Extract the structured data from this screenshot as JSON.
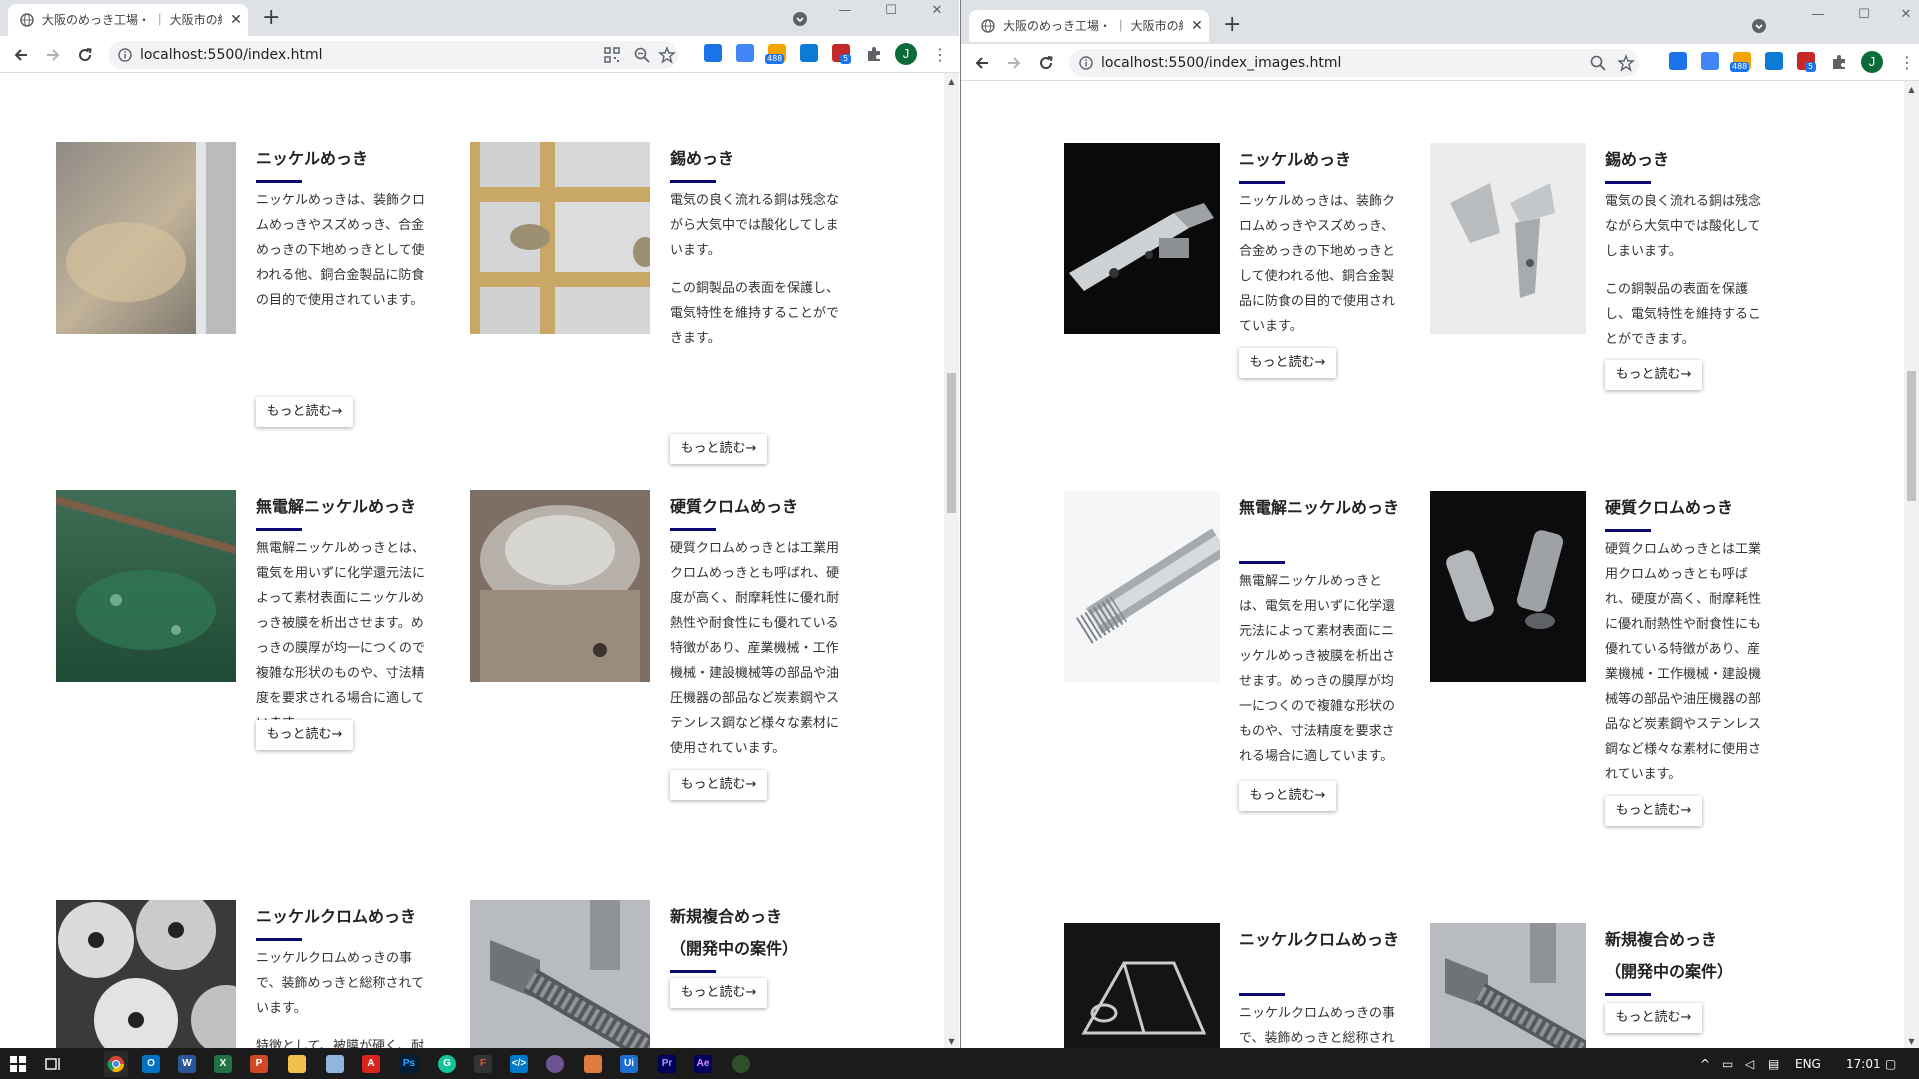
{
  "left_window": {
    "tab_title": "大阪のめっき工場・ ｜ 大阪市の紗",
    "url": "localhost:5500/index.html",
    "badge_count": "488",
    "ext_badge": "5",
    "profile_initial": "J",
    "cards": [
      {
        "title": "ニッケルめっき",
        "paragraphs": [
          "ニッケルめっきは、装飾クロムめっきやスズめっき、合金めっきの下地めっきとして使われる他、銅合金製品に防食の目的で使用されています。"
        ],
        "button": "もっと読む→"
      },
      {
        "title": "錫めっき",
        "paragraphs": [
          "電気の良く流れる銅は残念ながら大気中では酸化してしまいます。",
          "この銅製品の表面を保護し、電気特性を維持することができます。"
        ],
        "button": "もっと読む→"
      },
      {
        "title": "無電解ニッケルめっき",
        "paragraphs": [
          "無電解ニッケルめっきとは、電気を用いずに化学還元法によって素材表面にニッケルめっき被膜を析出させます。めっきの膜厚が均一につくので複雑な形状のものや、寸法精度を要求される場合に適しています。"
        ],
        "button": "もっと読む→"
      },
      {
        "title": "硬質クロムめっき",
        "paragraphs": [
          "硬質クロムめっきとは工業用クロムめっきとも呼ばれ、硬度が高く、耐摩耗性に優れ耐熱性や耐食性にも優れている特徴があり、産業機械・工作機械・建設機械等の部品や油圧機器の部品など炭素鋼やステンレス鋼など様々な素材に使用されています。"
        ],
        "button": "もっと読む→"
      },
      {
        "title": "ニッケルクロムめっき",
        "paragraphs": [
          "ニッケルクロムめっきの事で、装飾めっきと総称されています。",
          "特徴として、被膜が硬く、耐摩"
        ],
        "button": ""
      },
      {
        "title": "新規複合めっき（開発中の案件）",
        "paragraphs": [],
        "button": "もっと読む→"
      }
    ]
  },
  "right_window": {
    "tab_title": "大阪のめっき工場・ ｜ 大阪市の紗",
    "url": "localhost:5500/index_images.html",
    "badge_count": "488",
    "ext_badge": "5",
    "profile_initial": "J",
    "cards": [
      {
        "title": "ニッケルめっき",
        "paragraphs": [
          "ニッケルめっきは、装飾クロムめっきやスズめっき、合金めっきの下地めっきとして使われる他、銅合金製品に防食の目的で使用されています。"
        ],
        "button": "もっと読む→"
      },
      {
        "title": "錫めっき",
        "paragraphs": [
          "電気の良く流れる銅は残念ながら大気中では酸化してしまいます。",
          "この銅製品の表面を保護し、電気特性を維持することができます。"
        ],
        "button": "もっと読む→"
      },
      {
        "title": "無電解ニッケルめっき",
        "paragraphs": [
          "無電解ニッケルめっきとは、電気を用いずに化学還元法によって素材表面にニッケルめっき被膜を析出させます。めっきの膜厚が均一につくので複雑な形状のものや、寸法精度を要求される場合に適しています。"
        ],
        "button": "もっと読む→"
      },
      {
        "title": "硬質クロムめっき",
        "paragraphs": [
          "硬質クロムめっきとは工業用クロムめっきとも呼ばれ、硬度が高く、耐摩耗性に優れ耐熱性や耐食性にも優れている特徴があり、産業機械・工作機械・建設機械等の部品や油圧機器の部品など炭素鋼やステンレス鋼など様々な素材に使用されています。"
        ],
        "button": "もっと読む→"
      },
      {
        "title": "ニッケルクロムめっき",
        "paragraphs": [
          "ニッケルクロムめっきの事で、装飾めっきと総称され"
        ],
        "button": ""
      },
      {
        "title": "新規複合めっき（開発中の案件）",
        "paragraphs": [],
        "button": "もっと読む→"
      }
    ]
  },
  "taskbar": {
    "apps": [
      "chrome-icon",
      "outlook-icon",
      "word-icon",
      "excel-icon",
      "powerpoint-icon",
      "explorer-icon",
      "notepad-icon",
      "acrobat-icon",
      "photoshop-icon",
      "grammarly-icon",
      "figma-icon",
      "vscode-icon",
      "github-icon",
      "xd-icon",
      "uipath-icon",
      "premiere-icon",
      "aftereffects-icon",
      "gear-app-icon"
    ],
    "language": "ENG",
    "time": "17:01"
  },
  "colors": {
    "accent_rule": "#0a0a72",
    "chrome_frame": "#dee1e6",
    "taskbar": "#1b1b1b"
  }
}
